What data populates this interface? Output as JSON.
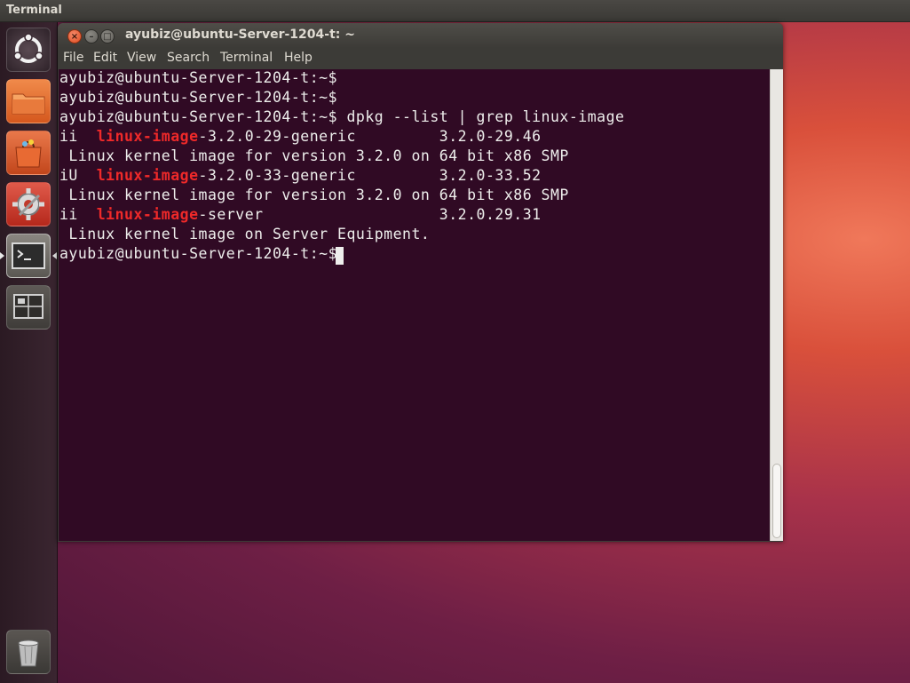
{
  "top_panel": {
    "title": "Terminal"
  },
  "launcher": {
    "items": [
      {
        "name": "dash-home"
      },
      {
        "name": "files"
      },
      {
        "name": "software-center"
      },
      {
        "name": "system-settings"
      },
      {
        "name": "terminal"
      },
      {
        "name": "workspace-switcher"
      },
      {
        "name": "trash"
      }
    ]
  },
  "window": {
    "title": "ayubiz@ubuntu-Server-1204-t: ~",
    "buttons": {
      "close": "×",
      "minimize": "–",
      "maximize": "□"
    }
  },
  "menu": {
    "items": [
      "File",
      "Edit",
      "View",
      "Search",
      "Terminal",
      "Help"
    ]
  },
  "terminal": {
    "lines": [
      {
        "pre": "ayubiz@ubuntu-Server-1204-t:~$",
        "hl": "",
        "post": ""
      },
      {
        "pre": "ayubiz@ubuntu-Server-1204-t:~$",
        "hl": "",
        "post": ""
      },
      {
        "pre": "ayubiz@ubuntu-Server-1204-t:~$ dpkg --list | grep linux-image",
        "hl": "",
        "post": ""
      },
      {
        "pre": "ii  ",
        "hl": "linux-image",
        "post": "-3.2.0-29-generic         3.2.0-29.46"
      },
      {
        "pre": " Linux kernel image for version 3.2.0 on 64 bit x86 SMP",
        "hl": "",
        "post": ""
      },
      {
        "pre": "iU  ",
        "hl": "linux-image",
        "post": "-3.2.0-33-generic         3.2.0-33.52"
      },
      {
        "pre": " Linux kernel image for version 3.2.0 on 64 bit x86 SMP",
        "hl": "",
        "post": ""
      },
      {
        "pre": "ii  ",
        "hl": "linux-image",
        "post": "-server                   3.2.0.29.31"
      },
      {
        "pre": " Linux kernel image on Server Equipment.",
        "hl": "",
        "post": ""
      },
      {
        "pre": "ayubiz@ubuntu-Server-1204-t:~$ ",
        "hl": "",
        "post": ""
      }
    ]
  },
  "colors": {
    "terminal_bg": "#300a24",
    "terminal_fg": "#eeeeec",
    "highlight": "#ef2929"
  }
}
